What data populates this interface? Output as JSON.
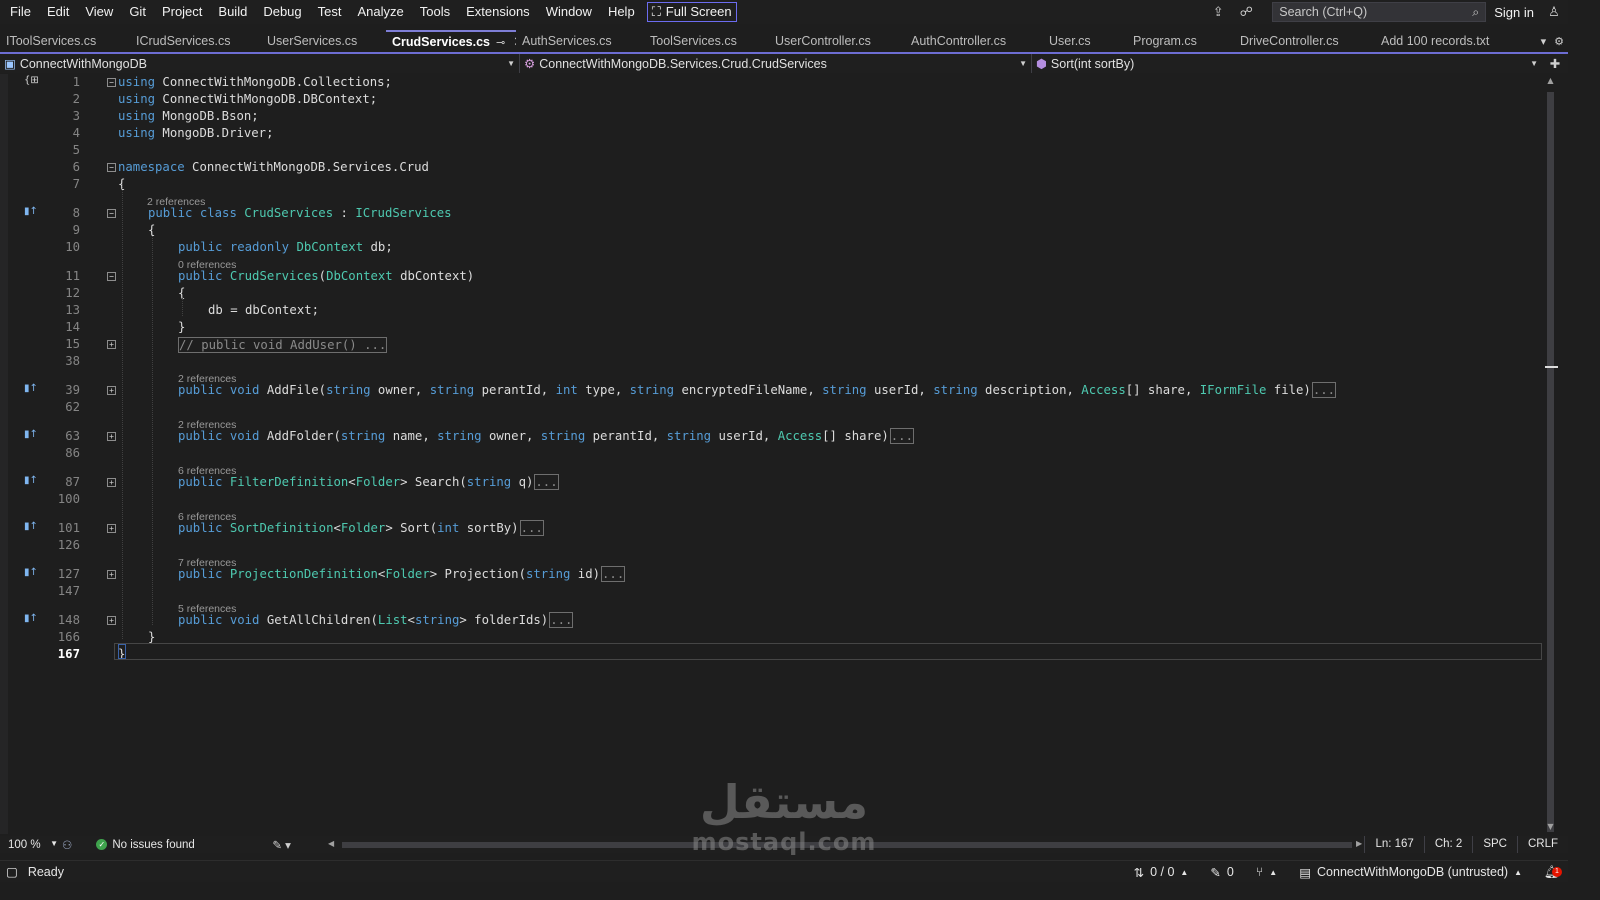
{
  "menu": [
    "File",
    "Edit",
    "View",
    "Git",
    "Project",
    "Build",
    "Debug",
    "Test",
    "Analyze",
    "Tools",
    "Extensions",
    "Window",
    "Help"
  ],
  "fullscreen_label": "Full Screen",
  "search_placeholder": "Search (Ctrl+Q)",
  "signin_label": "Sign in",
  "tabs": [
    {
      "label": "IToolServices.cs",
      "active": false
    },
    {
      "label": "ICrudServices.cs",
      "active": false
    },
    {
      "label": "UserServices.cs",
      "active": false
    },
    {
      "label": "CrudServices.cs",
      "active": true
    },
    {
      "label": "AuthServices.cs",
      "active": false
    },
    {
      "label": "ToolServices.cs",
      "active": false
    },
    {
      "label": "UserController.cs",
      "active": false
    },
    {
      "label": "AuthController.cs",
      "active": false
    },
    {
      "label": "User.cs",
      "active": false
    },
    {
      "label": "Program.cs",
      "active": false
    },
    {
      "label": "DriveController.cs",
      "active": false
    },
    {
      "label": "Add 100 records.txt",
      "active": false
    }
  ],
  "nav": {
    "project": "ConnectWithMongoDB",
    "class": "ConnectWithMongoDB.Services.Crud.CrudServices",
    "member": "Sort(int sortBy)"
  },
  "code_lines": [
    {
      "num": "1",
      "code": "using ConnectWithMongoDB.Collections;"
    },
    {
      "num": "2",
      "code": "using ConnectWithMongoDB.DBContext;"
    },
    {
      "num": "3",
      "code": "using MongoDB.Bson;"
    },
    {
      "num": "4",
      "code": "using MongoDB.Driver;"
    },
    {
      "num": "5",
      "code": ""
    },
    {
      "num": "6",
      "code": "namespace ConnectWithMongoDB.Services.Crud"
    },
    {
      "num": "7",
      "code": "{"
    },
    {
      "num": "8",
      "code": "public class CrudServices : ICrudServices",
      "refs": "2 references"
    },
    {
      "num": "9",
      "code": "{"
    },
    {
      "num": "10",
      "code": "public readonly DbContext db;"
    },
    {
      "num": "11",
      "code": "public CrudServices(DbContext dbContext)",
      "refs": "0 references"
    },
    {
      "num": "12",
      "code": "{"
    },
    {
      "num": "13",
      "code": "db = dbContext;"
    },
    {
      "num": "14",
      "code": "}"
    },
    {
      "num": "15",
      "code": "// public void AddUser() ..."
    },
    {
      "num": "38",
      "code": ""
    },
    {
      "num": "39",
      "code": "public void AddFile(string owner, string perantId, int type, string encryptedFileName, string userId, string description, Access[] share, IFormFile file)",
      "refs": "2 references"
    },
    {
      "num": "62",
      "code": ""
    },
    {
      "num": "63",
      "code": "public void AddFolder(string name, string owner, string perantId, string userId, Access[] share)",
      "refs": "2 references"
    },
    {
      "num": "86",
      "code": ""
    },
    {
      "num": "87",
      "code": "public FilterDefinition<Folder> Search(string q)",
      "refs": "6 references"
    },
    {
      "num": "100",
      "code": ""
    },
    {
      "num": "101",
      "code": "public SortDefinition<Folder> Sort(int sortBy)",
      "refs": "6 references"
    },
    {
      "num": "126",
      "code": ""
    },
    {
      "num": "127",
      "code": "public ProjectionDefinition<Folder> Projection(string id)",
      "refs": "7 references"
    },
    {
      "num": "147",
      "code": ""
    },
    {
      "num": "148",
      "code": "public void GetAllChildren(List<string> folderIds)",
      "refs": "5 references"
    },
    {
      "num": "166",
      "code": "}"
    },
    {
      "num": "167",
      "code": "}"
    }
  ],
  "ellipsis": "...",
  "editor_status": {
    "zoom": "100 %",
    "issues": "No issues found",
    "line": "Ln: 167",
    "char": "Ch: 2",
    "whitespace": "SPC",
    "eol": "CRLF"
  },
  "statusbar": {
    "ready": "Ready",
    "changes": "0 / 0",
    "pencil_count": "0",
    "repo": "ConnectWithMongoDB (untrusted)",
    "notifications": "1"
  },
  "watermark": {
    "arabic": "مستقل",
    "latin": "mostaql.com"
  },
  "colors": {
    "keyword": "#569cd6",
    "type": "#4ec9b0",
    "accent": "#6d6dd3",
    "comment": "#6a9955"
  }
}
